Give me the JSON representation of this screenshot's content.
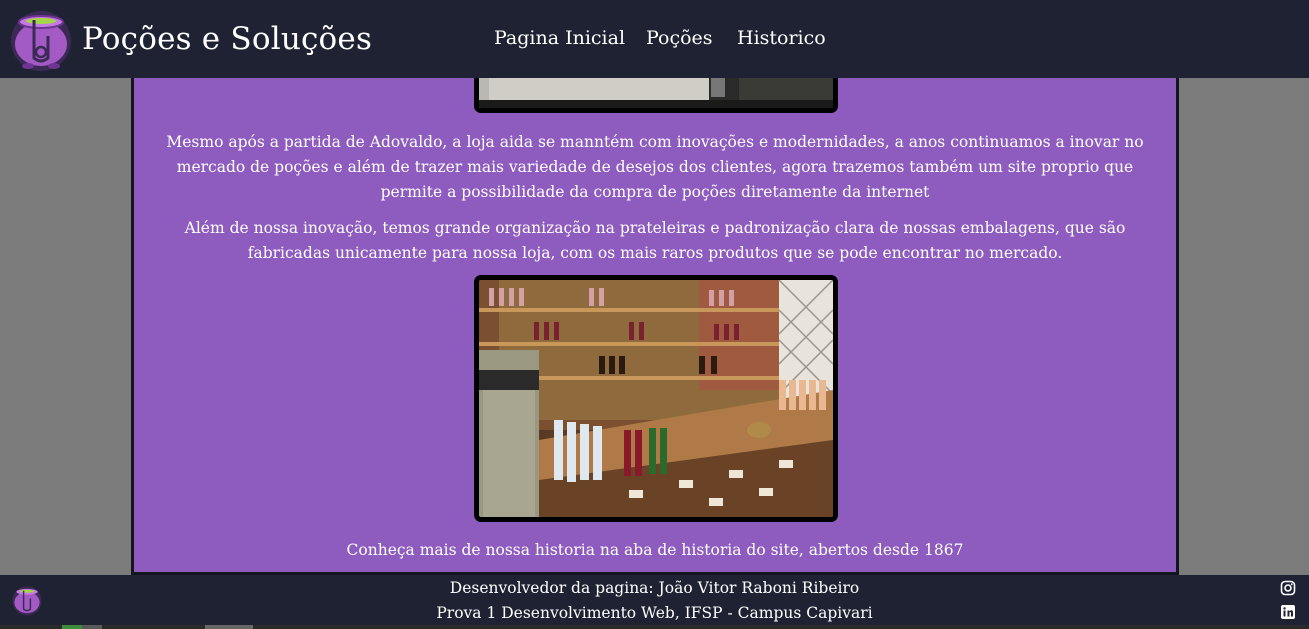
{
  "header": {
    "brand_title": "Poções e Soluções",
    "logo_icon": "cauldron-logo-icon",
    "nav": [
      {
        "label": "Pagina Inicial"
      },
      {
        "label": "Poções"
      },
      {
        "label": "Historico"
      }
    ]
  },
  "main": {
    "paragraphs": [
      "Mesmo após a partida de Adovaldo, a loja aida se manntém com inovações e modernidades, a anos continuamos a inovar no mercado de poções e além de trazer mais variedade de desejos dos clientes, agora trazemos também um site proprio que permite a possibilidade da compra de poções diretamente da internet",
      "Além de nossa inovação, temos grande organização na prateleiras e padronização clara de nossas embalagens, que são fabricadas unicamente para nossa loja, com os mais raros produtos que se pode encontrar no mercado.",
      "Conheça mais de nossa historia na aba de historia do site, abertos desde 1867"
    ],
    "images": [
      {
        "name": "storefront-photo"
      },
      {
        "name": "potion-shelves-photo"
      }
    ]
  },
  "footer": {
    "developer": "Desenvolvedor da pagina: João Vitor Raboni Ribeiro",
    "course": "Prova 1 Desenvolvimento Web, IFSP - Campus Capivari",
    "social": [
      "instagram-icon",
      "linkedin-icon"
    ]
  },
  "colors": {
    "header_bg": "#1f2233",
    "panel_bg": "#8e5bbe",
    "page_bg": "#7b7b7b",
    "text": "#ffffff",
    "logo_purple": "#a35ac4"
  }
}
